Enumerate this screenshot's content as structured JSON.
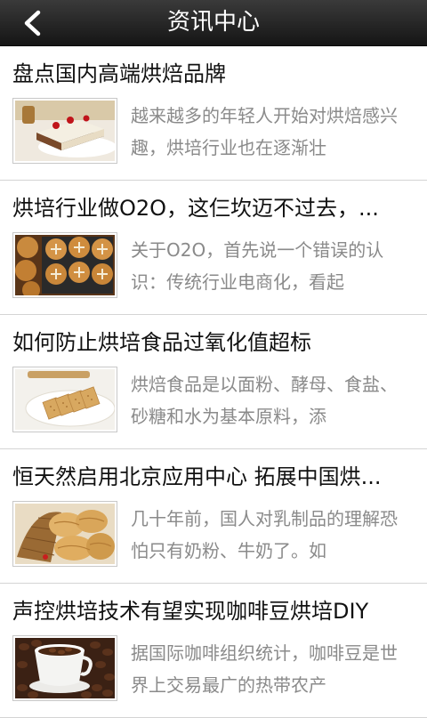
{
  "header": {
    "title": "资讯中心",
    "back_icon": "chevron-left-icon"
  },
  "articles": [
    {
      "title": "盘点国内高端烘焙品牌",
      "summary": "越来越多的年轻人开始对烘焙感兴趣，烘培行业也在逐渐壮",
      "thumbnail": "cake-slice-image"
    },
    {
      "title": "烘培行业做O2O，这仨坎迈不过去，...",
      "summary": "关于O2O，首先说一个错误的认识：传统行业电商化，看起",
      "thumbnail": "buns-tray-image"
    },
    {
      "title": "如何防止烘培食品过氧化值超标",
      "summary": "烘焙食品是以面粉、酵母、食盐、砂糖和水为基本原料，添",
      "thumbnail": "biscuits-plate-image"
    },
    {
      "title": "恒天然启用北京应用中心 拓展中国烘...",
      "summary": "几十年前，国人对乳制品的理解恐怕只有奶粉、牛奶了。如",
      "thumbnail": "bread-basket-image"
    },
    {
      "title": "声控烘培技术有望实现咖啡豆烘培DIY",
      "summary": "据国际咖啡组织统计，咖啡豆是世界上交易最广的热带农产",
      "thumbnail": "coffee-beans-image"
    }
  ]
}
